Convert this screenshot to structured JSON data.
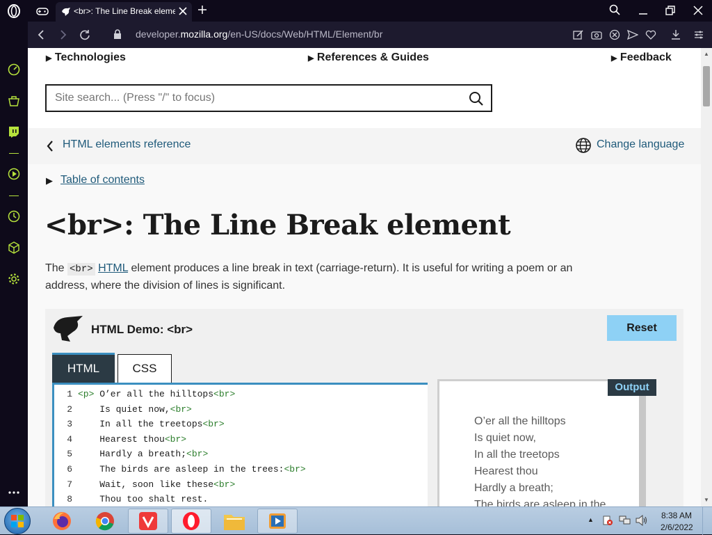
{
  "browser": {
    "tab_title": "<br>: The Line Break eleme",
    "url_host": "developer.",
    "url_domain": "mozilla.org",
    "url_path": "/en-US/docs/Web/HTML/Element/br"
  },
  "header_nav": {
    "technologies": "Technologies",
    "references": "References & Guides",
    "feedback": "Feedback"
  },
  "search": {
    "placeholder": "Site search... (Press \"/\" to focus)"
  },
  "breadcrumb": {
    "back_link": "HTML elements reference",
    "change_language": "Change language"
  },
  "toc": {
    "label": "Table of contents"
  },
  "article": {
    "title": "<br>: The Line Break element",
    "intro_prefix": "The ",
    "intro_code": "<br>",
    "intro_link": "HTML",
    "intro_line1_rest": " element produces a line break in text (carriage-return). It is useful for writing a poem or an",
    "intro_line2": "address, where the division of lines is significant."
  },
  "demo": {
    "title": "HTML Demo: <br>",
    "reset": "Reset",
    "tab_html": "HTML",
    "tab_css": "CSS",
    "output_label": "Output",
    "code": [
      {
        "n": "1",
        "pre": "",
        "open": "<p>",
        "text": " O’er all the hilltops",
        "close": "<br>"
      },
      {
        "n": "2",
        "pre": "    ",
        "open": "",
        "text": "Is quiet now,",
        "close": "<br>"
      },
      {
        "n": "3",
        "pre": "    ",
        "open": "",
        "text": "In all the treetops",
        "close": "<br>"
      },
      {
        "n": "4",
        "pre": "    ",
        "open": "",
        "text": "Hearest thou",
        "close": "<br>"
      },
      {
        "n": "5",
        "pre": "    ",
        "open": "",
        "text": "Hardly a breath;",
        "close": "<br>"
      },
      {
        "n": "6",
        "pre": "    ",
        "open": "",
        "text": "The birds are asleep in the trees:",
        "close": "<br>"
      },
      {
        "n": "7",
        "pre": "    ",
        "open": "",
        "text": "Wait, soon like these",
        "close": "<br>"
      },
      {
        "n": "8",
        "pre": "    ",
        "open": "",
        "text": "Thou too shalt rest.",
        "close": ""
      }
    ],
    "output": [
      "O’er all the hilltops",
      "Is quiet now,",
      "In all the treetops",
      "Hearest thou",
      "Hardly a breath;",
      "The birds are asleep in the"
    ]
  },
  "taskbar": {
    "time": "8:38 AM",
    "date": "2/6/2022"
  },
  "colors": {
    "opera_accent": "#b6e23c",
    "link": "#1f5a7a",
    "reset_bg": "#8ed1f5",
    "page_bg": "#ffffff"
  }
}
